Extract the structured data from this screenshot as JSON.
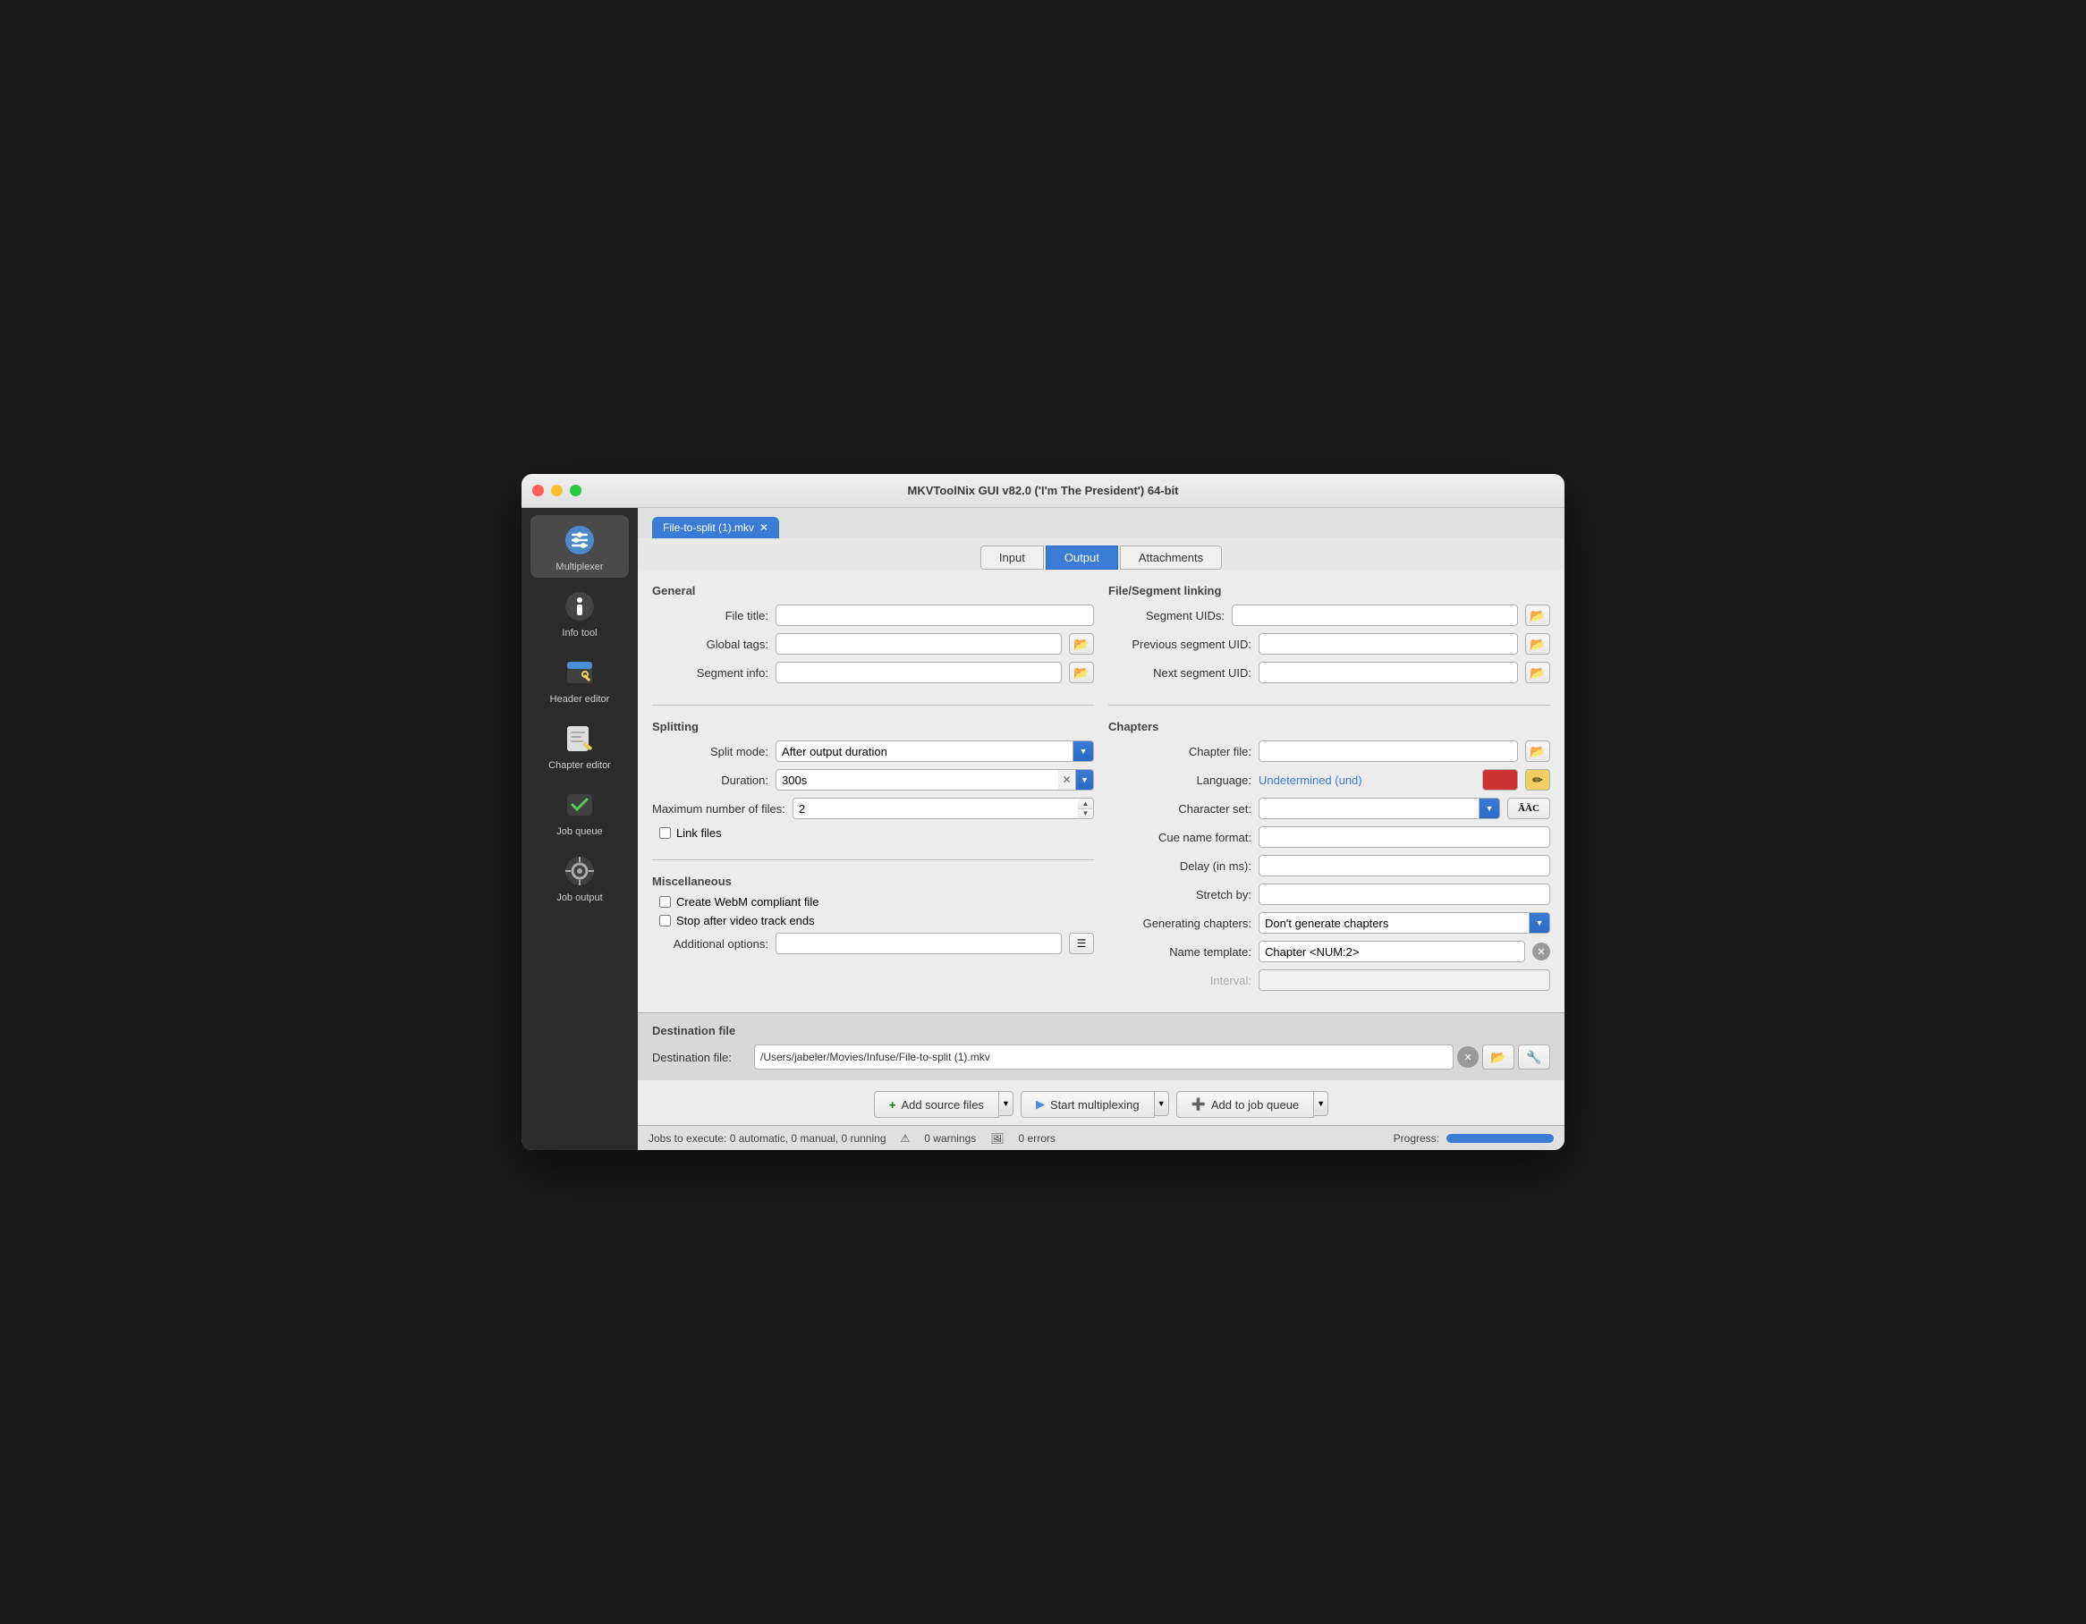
{
  "window": {
    "title": "MKVToolNix GUI v82.0 ('I'm The President') 64-bit"
  },
  "sidebar": {
    "items": [
      {
        "id": "multiplexer",
        "label": "Multiplexer",
        "icon": "⚙",
        "active": true
      },
      {
        "id": "info-tool",
        "label": "Info tool",
        "icon": "🔍"
      },
      {
        "id": "header-editor",
        "label": "Header editor",
        "icon": "✏"
      },
      {
        "id": "chapter-editor",
        "label": "Chapter editor",
        "icon": "📝"
      },
      {
        "id": "job-queue",
        "label": "Job queue",
        "icon": "☑"
      },
      {
        "id": "job-output",
        "label": "Job output",
        "icon": "⚙"
      }
    ]
  },
  "file_tab": {
    "name": "File-to-split (1).mkv",
    "close_label": "✕"
  },
  "nav_tabs": [
    {
      "id": "input",
      "label": "Input"
    },
    {
      "id": "output",
      "label": "Output",
      "active": true
    },
    {
      "id": "attachments",
      "label": "Attachments"
    }
  ],
  "general": {
    "title": "General",
    "file_title_label": "File title:",
    "file_title_value": "",
    "global_tags_label": "Global tags:",
    "global_tags_value": "",
    "segment_info_label": "Segment info:",
    "segment_info_value": ""
  },
  "splitting": {
    "title": "Splitting",
    "split_mode_label": "Split mode:",
    "split_mode_value": "After output duration",
    "duration_label": "Duration:",
    "duration_value": "300s",
    "max_files_label": "Maximum number of files:",
    "max_files_value": "2",
    "link_files_label": "Link files"
  },
  "miscellaneous": {
    "title": "Miscellaneous",
    "create_webm_label": "Create WebM compliant file",
    "stop_video_label": "Stop after video track ends",
    "additional_options_label": "Additional options:"
  },
  "file_segment_linking": {
    "title": "File/Segment linking",
    "segment_uids_label": "Segment UIDs:",
    "segment_uids_value": "",
    "prev_segment_uid_label": "Previous segment UID:",
    "prev_segment_uid_value": "",
    "next_segment_uid_label": "Next segment UID:",
    "next_segment_uid_value": ""
  },
  "chapters": {
    "title": "Chapters",
    "chapter_file_label": "Chapter file:",
    "chapter_file_value": "",
    "language_label": "Language:",
    "language_value": "Undetermined (und)",
    "character_set_label": "Character set:",
    "character_set_value": "",
    "cue_name_format_label": "Cue name format:",
    "cue_name_format_value": "",
    "delay_label": "Delay (in ms):",
    "delay_value": "",
    "stretch_by_label": "Stretch by:",
    "stretch_by_value": "",
    "generating_chapters_label": "Generating chapters:",
    "generating_chapters_value": "Don't generate chapters",
    "name_template_label": "Name template:",
    "name_template_value": "Chapter <NUM:2>",
    "interval_label": "Interval:",
    "interval_value": ""
  },
  "destination": {
    "title": "Destination file",
    "label": "Destination file:",
    "path": "/Users/jabeler/Movies/Infuse/File-to-split (1).mkv"
  },
  "actions": {
    "add_source_files": "Add source files",
    "start_multiplexing": "Start multiplexing",
    "add_to_job_queue": "Add to job queue"
  },
  "status_bar": {
    "jobs_text": "Jobs to execute:  0 automatic, 0 manual, 0 running",
    "warnings_text": "0 warnings",
    "errors_text": "0 errors",
    "progress_label": "Progress:"
  },
  "icons": {
    "folder": "📂",
    "plus": "+",
    "play": "▶",
    "add_queue": "➕",
    "warning": "⚠",
    "error": "🖼",
    "clear": "✕",
    "chevron_down": "▼",
    "chevron_up": "▲",
    "list": "☰"
  },
  "progress": {
    "value": 100,
    "color": "#3a7bd5"
  }
}
